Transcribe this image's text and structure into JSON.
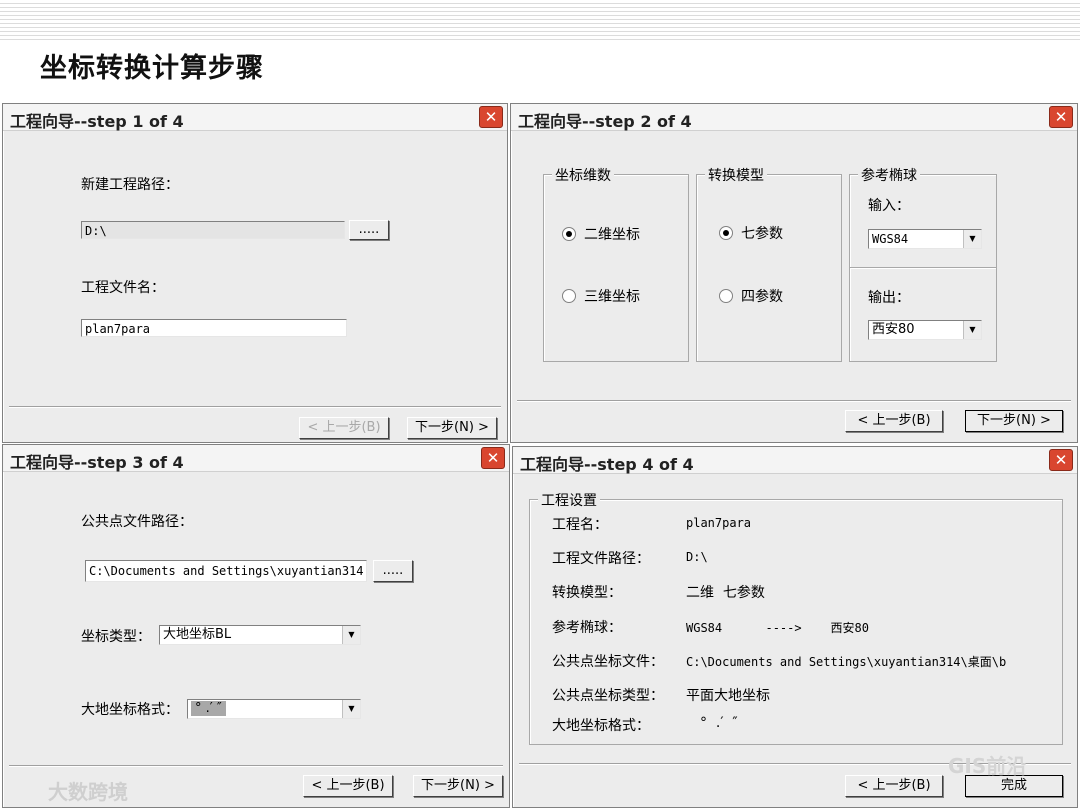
{
  "slide": {
    "title": "坐标转换计算步骤"
  },
  "watermarks": {
    "left": "大数跨境",
    "right": "GIS前沿"
  },
  "step1": {
    "title": "工程向导--step 1 of 4",
    "close": "✕",
    "path_label": "新建工程路径：",
    "path_value": "D:\\",
    "browse_label": ".....",
    "file_label": "工程文件名：",
    "file_value": "plan7para",
    "back_label": "< 上一步(B)",
    "next_label": "下一步(N) >"
  },
  "step2": {
    "title": "工程向导--step 2 of 4",
    "close": "✕",
    "dim_group": "坐标维数",
    "dim_2d": "二维坐标",
    "dim_3d": "三维坐标",
    "model_group": "转换模型",
    "model_7": "七参数",
    "model_4": "四参数",
    "ellipsoid_group": "参考椭球",
    "input_label": "输入：",
    "input_value": "WGS84",
    "output_label": "输出：",
    "output_value": "西安80",
    "back_label": "< 上一步(B)",
    "next_label": "下一步(N) >"
  },
  "step3": {
    "title": "工程向导--step 3 of 4",
    "close": "✕",
    "path_label": "公共点文件路径：",
    "path_value": "C:\\Documents and Settings\\xuyantian314",
    "browse_label": ".....",
    "type_label": "坐标类型：",
    "type_value": "大地坐标BL",
    "format_label": "大地坐标格式：",
    "format_value": "°  .′  ″",
    "back_label": "< 上一步(B)",
    "next_label": "下一步(N) >"
  },
  "step4": {
    "title": "工程向导--step 4 of 4",
    "close": "✕",
    "group": "工程设置",
    "rows": [
      {
        "label": "工程名：",
        "value": "plan7para"
      },
      {
        "label": "工程文件路径：",
        "value": "D:\\"
      },
      {
        "label": "转换模型：",
        "value": "二维  七参数"
      },
      {
        "label": "参考椭球：",
        "value": "WGS84      ---->    西安80"
      },
      {
        "label": "公共点坐标文件：",
        "value": "C:\\Documents and Settings\\xuyantian314\\桌面\\b"
      },
      {
        "label": "公共点坐标类型：",
        "value": "平面大地坐标"
      },
      {
        "label": "大地坐标格式：",
        "value": "°  .′  ″"
      }
    ],
    "back_label": "< 上一步(B)",
    "finish_label": "完成"
  }
}
